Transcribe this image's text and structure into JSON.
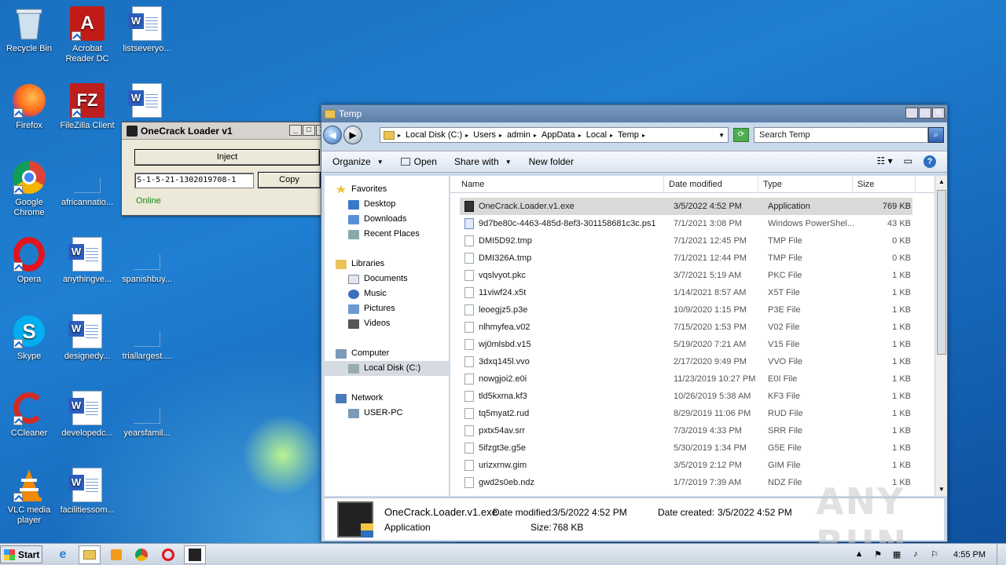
{
  "desktop": {
    "icons": [
      {
        "label": "Recycle Bin",
        "icon": "recycle-bin-icon"
      },
      {
        "label": "Acrobat Reader DC",
        "icon": "acrobat-icon"
      },
      {
        "label": "listseveryo...",
        "icon": "word-document-icon"
      },
      {
        "label": "Firefox",
        "icon": "firefox-icon"
      },
      {
        "label": "FileZilla Client",
        "icon": "filezilla-icon"
      },
      {
        "label": "",
        "icon": "word-document-icon"
      },
      {
        "label": "Google Chrome",
        "icon": "chrome-icon"
      },
      {
        "label": "africannatio...",
        "icon": "blank-file-icon"
      },
      {
        "label": "Opera",
        "icon": "opera-icon"
      },
      {
        "label": "anythingve...",
        "icon": "word-document-icon"
      },
      {
        "label": "spanishbuy...",
        "icon": "blank-file-icon"
      },
      {
        "label": "Skype",
        "icon": "skype-icon"
      },
      {
        "label": "designedy...",
        "icon": "word-document-icon"
      },
      {
        "label": "triallargest....",
        "icon": "blank-file-icon"
      },
      {
        "label": "CCleaner",
        "icon": "ccleaner-icon"
      },
      {
        "label": "developedc...",
        "icon": "word-document-icon"
      },
      {
        "label": "yearsfamil...",
        "icon": "blank-file-icon"
      },
      {
        "label": "VLC media player",
        "icon": "vlc-icon"
      },
      {
        "label": "facilitiessom...",
        "icon": "word-document-icon"
      }
    ]
  },
  "loader": {
    "title": "OneCrack Loader v1",
    "inject_label": "Inject",
    "sid_value": "S-1-5-21-1302019708-1",
    "copy_label": "Copy",
    "status": "Online",
    "status_color": "#1a8a1a"
  },
  "explorer": {
    "title": "Temp",
    "breadcrumbs": [
      "Local Disk (C:)",
      "Users",
      "admin",
      "AppData",
      "Local",
      "Temp"
    ],
    "search_placeholder": "Search Temp",
    "toolbar": {
      "organize": "Organize",
      "open": "Open",
      "share_with": "Share with",
      "new_folder": "New folder"
    },
    "nav": {
      "favorites": "Favorites",
      "desktop": "Desktop",
      "downloads": "Downloads",
      "recent_places": "Recent Places",
      "libraries": "Libraries",
      "documents": "Documents",
      "music": "Music",
      "pictures": "Pictures",
      "videos": "Videos",
      "computer": "Computer",
      "local_disk": "Local Disk (C:)",
      "network": "Network",
      "user_pc": "USER-PC"
    },
    "columns": {
      "name": "Name",
      "date_modified": "Date modified",
      "type": "Type",
      "size": "Size"
    },
    "files": [
      {
        "name": "OneCrack.Loader.v1.exe",
        "date": "3/5/2022 4:52 PM",
        "type": "Application",
        "size": "769 KB"
      },
      {
        "name": "9d7be80c-4463-485d-8ef3-301158681c3c.ps1",
        "date": "7/1/2021 3:08 PM",
        "type": "Windows PowerShel...",
        "size": "43 KB"
      },
      {
        "name": "DMI5D92.tmp",
        "date": "7/1/2021 12:45 PM",
        "type": "TMP File",
        "size": "0 KB"
      },
      {
        "name": "DMI326A.tmp",
        "date": "7/1/2021 12:44 PM",
        "type": "TMP File",
        "size": "0 KB"
      },
      {
        "name": "vqslvyot.pkc",
        "date": "3/7/2021 5:19 AM",
        "type": "PKC File",
        "size": "1 KB"
      },
      {
        "name": "11viwf24.x5t",
        "date": "1/14/2021 8:57 AM",
        "type": "X5T File",
        "size": "1 KB"
      },
      {
        "name": "leoegjz5.p3e",
        "date": "10/9/2020 1:15 PM",
        "type": "P3E File",
        "size": "1 KB"
      },
      {
        "name": "nlhmyfea.v02",
        "date": "7/15/2020 1:53 PM",
        "type": "V02 File",
        "size": "1 KB"
      },
      {
        "name": "wj0mlsbd.v15",
        "date": "5/19/2020 7:21 AM",
        "type": "V15 File",
        "size": "1 KB"
      },
      {
        "name": "3dxq145l.vvo",
        "date": "2/17/2020 9:49 PM",
        "type": "VVO File",
        "size": "1 KB"
      },
      {
        "name": "nowgjoi2.e0i",
        "date": "11/23/2019 10:27 PM",
        "type": "E0I File",
        "size": "1 KB"
      },
      {
        "name": "tld5kxma.kf3",
        "date": "10/26/2019 5:38 AM",
        "type": "KF3 File",
        "size": "1 KB"
      },
      {
        "name": "tq5myat2.rud",
        "date": "8/29/2019 11:06 PM",
        "type": "RUD File",
        "size": "1 KB"
      },
      {
        "name": "pxtx54av.srr",
        "date": "7/3/2019 4:33 PM",
        "type": "SRR File",
        "size": "1 KB"
      },
      {
        "name": "5ifzgt3e.g5e",
        "date": "5/30/2019 1:34 PM",
        "type": "G5E File",
        "size": "1 KB"
      },
      {
        "name": "urizxrnw.gim",
        "date": "3/5/2019 2:12 PM",
        "type": "GIM File",
        "size": "1 KB"
      },
      {
        "name": "gwd2s0eb.ndz",
        "date": "1/7/2019 7:39 AM",
        "type": "NDZ File",
        "size": "1 KB"
      }
    ],
    "details": {
      "filename": "OneCrack.Loader.v1.exe",
      "date_modified_label": "Date modified:",
      "date_modified": "3/5/2022 4:52 PM",
      "date_created_label": "Date created:",
      "date_created": "3/5/2022 4:52 PM",
      "type": "Application",
      "size_label": "Size:",
      "size": "768 KB"
    }
  },
  "taskbar": {
    "start_label": "Start",
    "clock": "4:55 PM"
  },
  "watermark": "ANY RUN"
}
